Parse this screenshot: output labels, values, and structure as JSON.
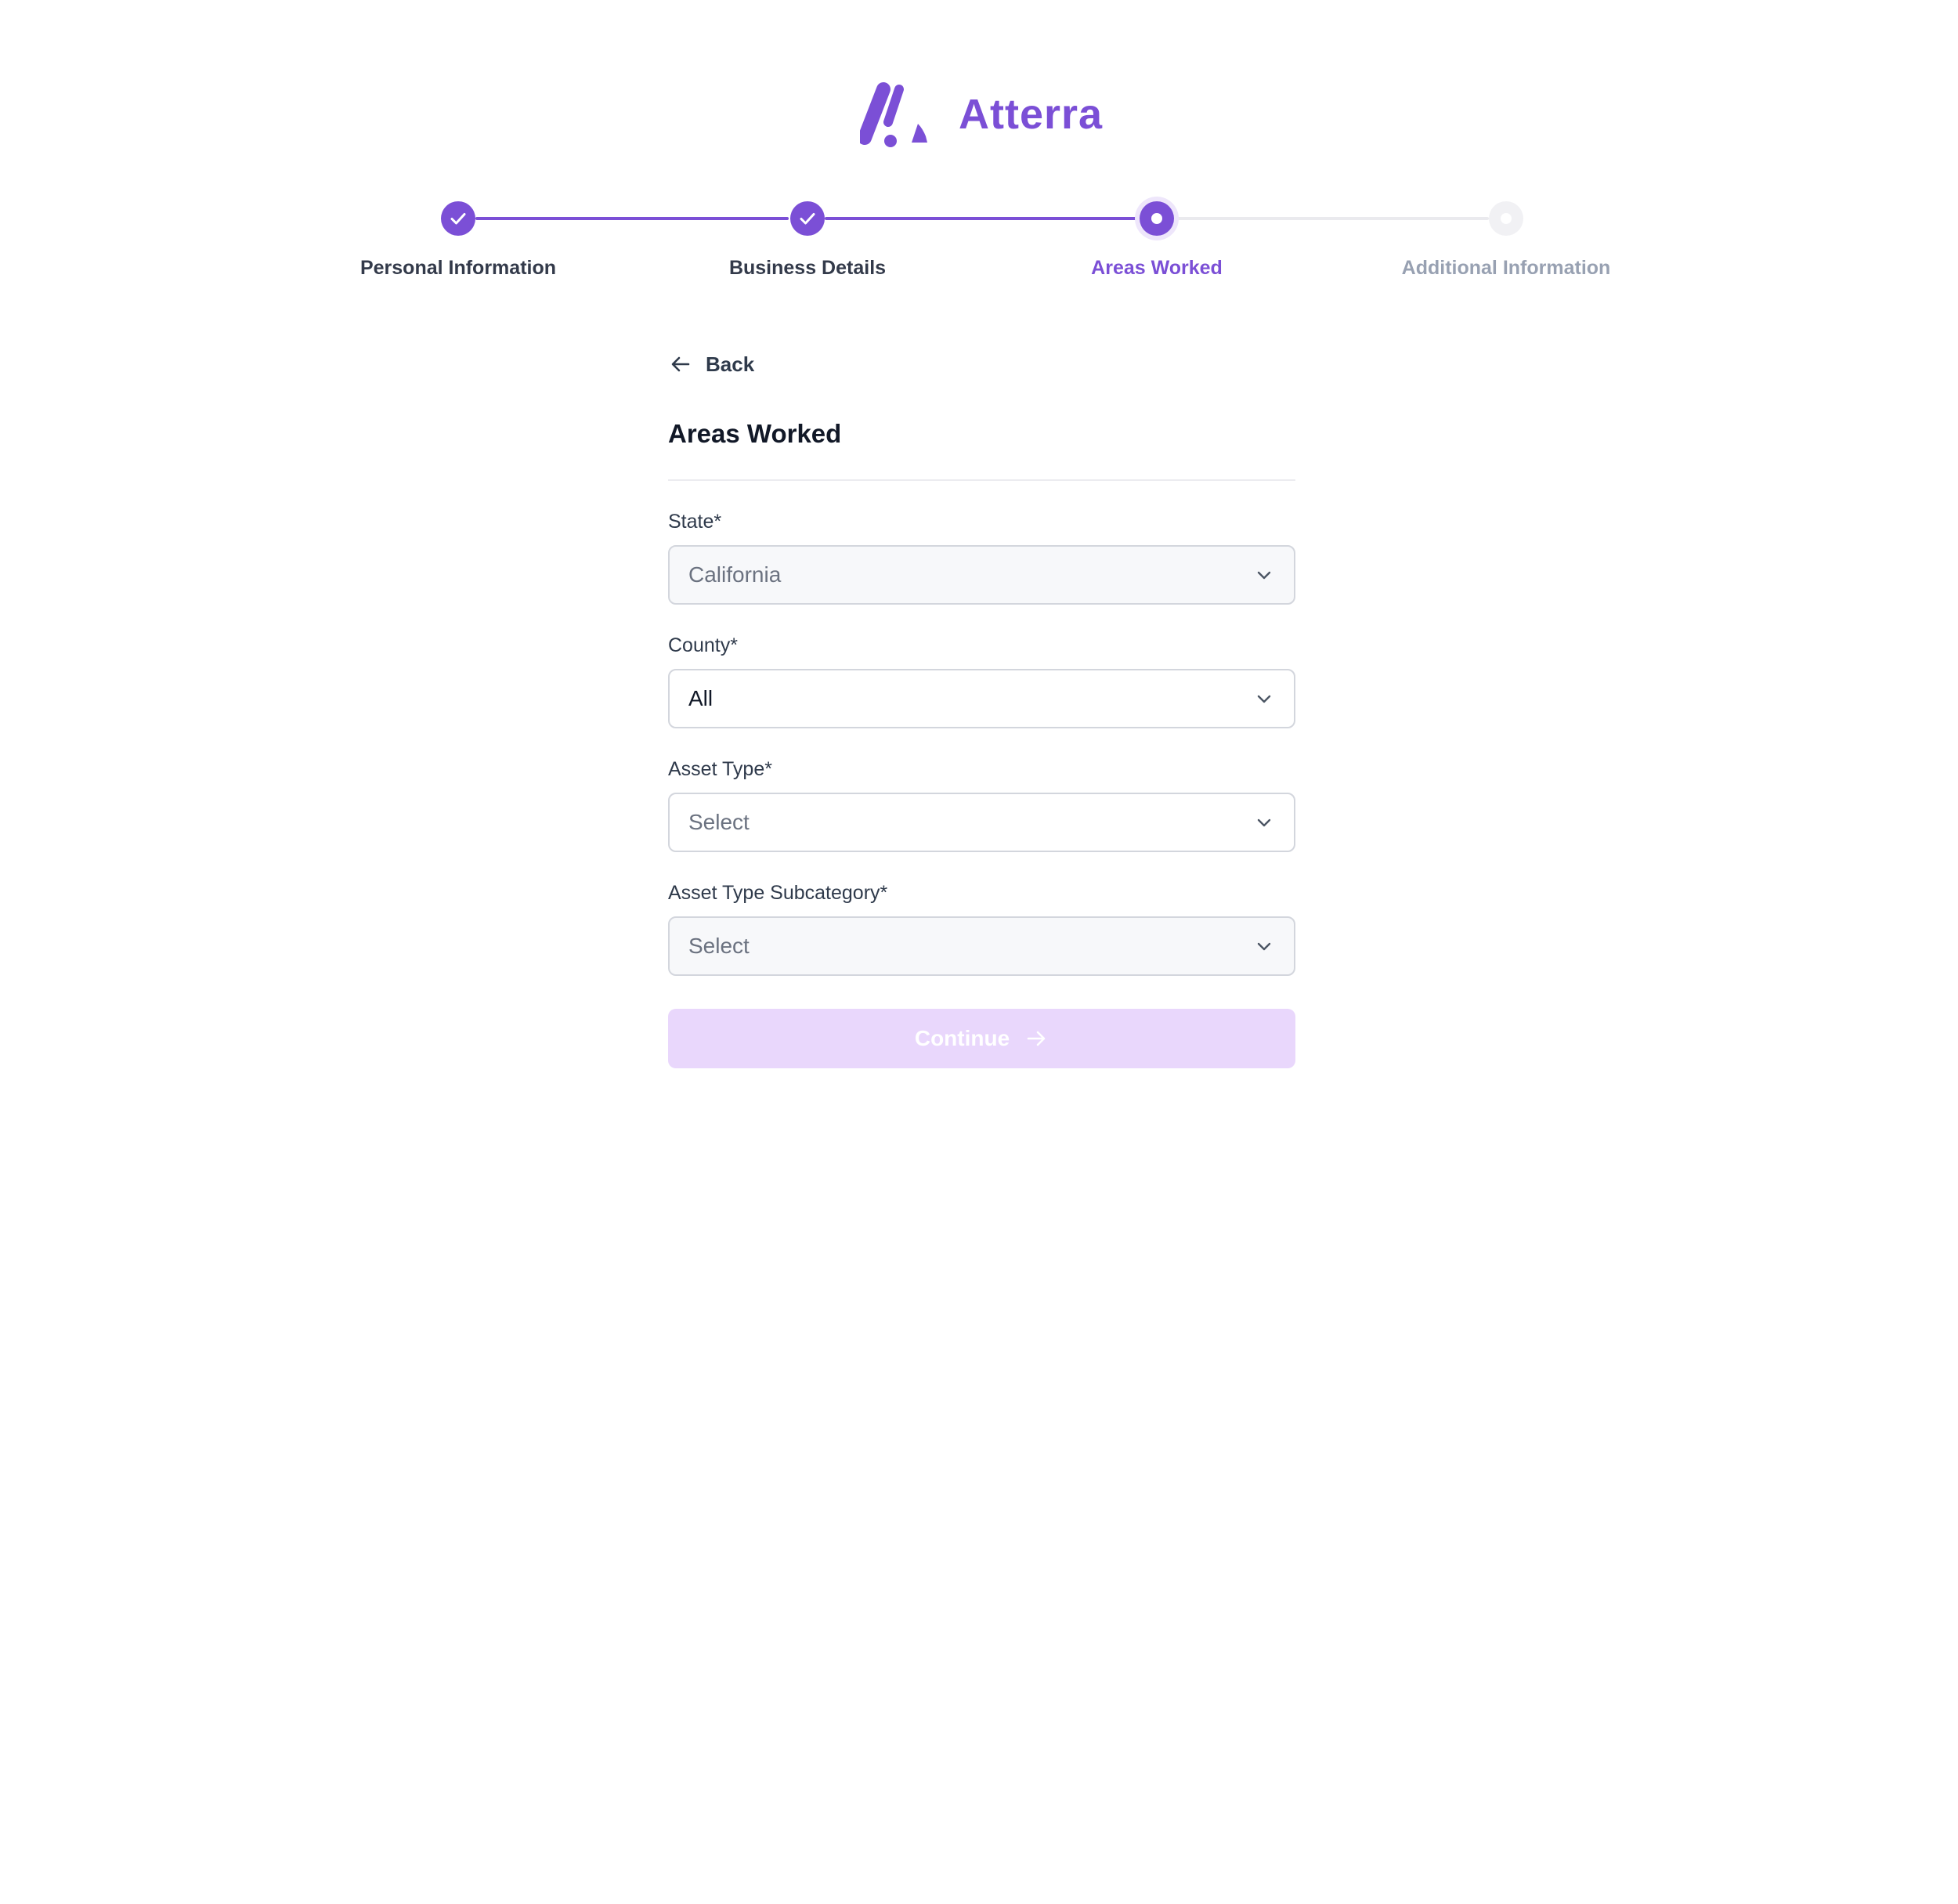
{
  "brand": {
    "name": "Atterra",
    "logo_icon": "atterra-logo-icon",
    "accent_color": "#7b4fd6"
  },
  "stepper": {
    "current_step": 3,
    "steps": [
      {
        "label": "Personal Information",
        "status": "completed",
        "icon": "check-icon"
      },
      {
        "label": "Business Details",
        "status": "completed",
        "icon": "check-icon"
      },
      {
        "label": "Areas Worked",
        "status": "current",
        "icon": "dot-icon"
      },
      {
        "label": "Additional Information",
        "status": "upcoming",
        "icon": "dot-icon"
      }
    ]
  },
  "form": {
    "back_label": "Back",
    "back_icon": "arrow-left-icon",
    "title": "Areas Worked",
    "fields": [
      {
        "label": "State*",
        "value": "California",
        "state": "disabled",
        "icon": "chevron-down-icon"
      },
      {
        "label": "County*",
        "value": "All",
        "state": "enabled",
        "icon": "chevron-down-icon"
      },
      {
        "label": "Asset Type*",
        "value": "Select",
        "state": "enabled-placeholder",
        "icon": "chevron-down-icon"
      },
      {
        "label": "Asset Type Subcategory*",
        "value": "Select",
        "state": "disabled",
        "icon": "chevron-down-icon"
      }
    ],
    "continue_label": "Continue",
    "continue_icon": "arrow-right-icon",
    "continue_disabled": true
  }
}
